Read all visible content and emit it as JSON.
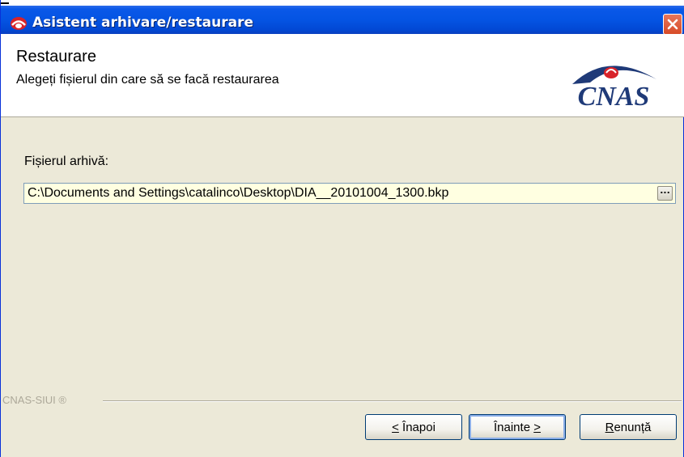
{
  "window": {
    "title": "Asistent arhivare/restaurare",
    "title_icon": "cnas-app-icon",
    "close_icon": "close-icon"
  },
  "header": {
    "title": "Restaurare",
    "subtitle": "Alegeți fișierul din care să se facă restaurarea",
    "logo_text": "CNAS"
  },
  "form": {
    "archive_label": "Fișierul arhivă:",
    "archive_path": "C:\\Documents and Settings\\catalinco\\Desktop\\DIA__20101004_1300.bkp",
    "browse_label": "...",
    "field_background": "#ffffe1"
  },
  "footer": {
    "brand": "CNAS-SIUI ®"
  },
  "buttons": {
    "back_mnemonic": "<",
    "back_label": " Înapoi",
    "next_label": "Înainte ",
    "next_mnemonic": ">",
    "cancel_mnemonic": "R",
    "cancel_rest": "enunță"
  },
  "colors": {
    "titlebar": "#0454e3",
    "window_bg": "#ece9d8",
    "close_button": "#d74b28",
    "logo_navy": "#1f3a78",
    "logo_red": "#d8232a"
  }
}
